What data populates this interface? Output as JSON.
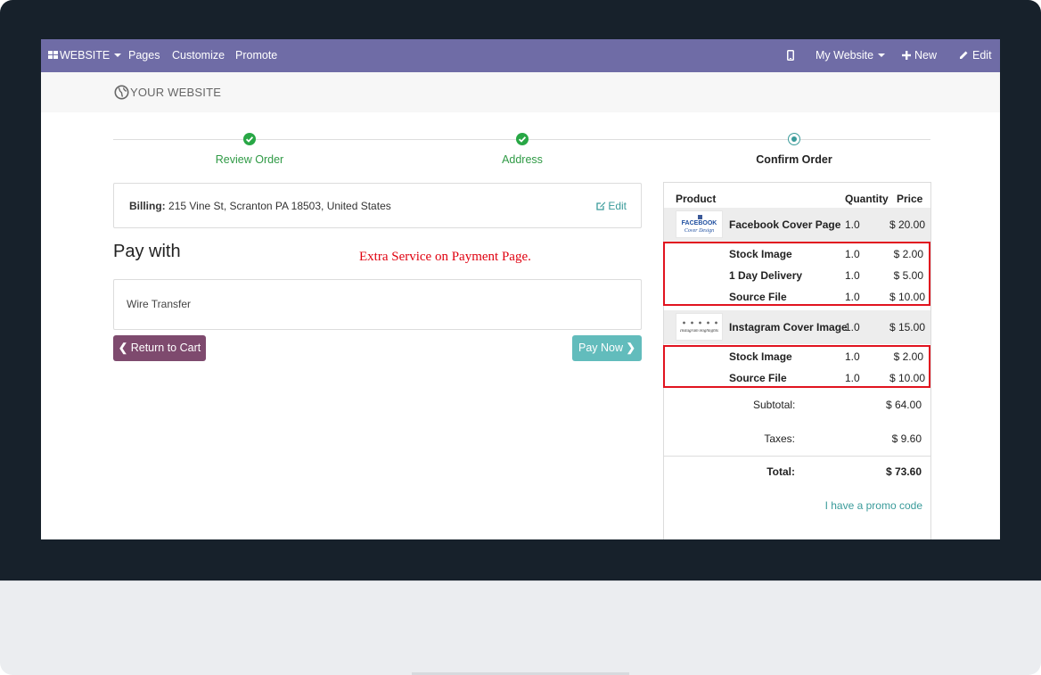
{
  "admin_bar": {
    "website_label": "WEBSITE",
    "pages_label": "Pages",
    "customize_label": "Customize",
    "promote_label": "Promote",
    "my_website_label": "My Website",
    "new_label": "New",
    "edit_label": "Edit",
    "icons": {
      "apps": "grid-icon",
      "mobile": "mobile-icon",
      "new": "plus-icon",
      "edit": "pencil-icon"
    }
  },
  "site": {
    "logo_text": "YOUR WEBSITE",
    "logo_icon": "globe-icon"
  },
  "steps": [
    {
      "label": "Review Order",
      "state": "done"
    },
    {
      "label": "Address",
      "state": "done"
    },
    {
      "label": "Confirm Order",
      "state": "current"
    }
  ],
  "billing": {
    "label": "Billing:",
    "address": "215 Vine St, Scranton PA 18503, United States",
    "edit_label": "Edit"
  },
  "payment": {
    "heading": "Pay with",
    "annotation": "Extra Service on Payment Page.",
    "method": "Wire Transfer",
    "return_label": "Return to Cart",
    "pay_label": "Pay Now"
  },
  "summary": {
    "headers": {
      "product": "Product",
      "quantity": "Quantity",
      "price": "Price"
    },
    "products": [
      {
        "name": "Facebook Cover Page",
        "quantity": "1.0",
        "price": "$ 20.00",
        "thumb_line1": "FACEBOOK",
        "thumb_line2": "Cover Design",
        "extras": [
          {
            "name": "Stock Image",
            "quantity": "1.0",
            "price": "$ 2.00"
          },
          {
            "name": "1 Day Delivery",
            "quantity": "1.0",
            "price": "$ 5.00"
          },
          {
            "name": "Source File",
            "quantity": "1.0",
            "price": "$ 10.00"
          }
        ]
      },
      {
        "name": "Instagram Cover Image",
        "quantity": "1.0",
        "price": "$ 15.00",
        "thumb_line1": "Instagram Highlights",
        "extras": [
          {
            "name": "Stock Image",
            "quantity": "1.0",
            "price": "$ 2.00"
          },
          {
            "name": "Source File",
            "quantity": "1.0",
            "price": "$ 10.00"
          }
        ]
      }
    ],
    "subtotal_label": "Subtotal:",
    "subtotal": "$ 64.00",
    "taxes_label": "Taxes:",
    "taxes": "$ 9.60",
    "total_label": "Total:",
    "total": "$ 73.60",
    "promo_label": "I have a promo code"
  },
  "colors": {
    "admin_bar": "#6f6ca6",
    "step_done": "#28a745",
    "step_current": "#3a9b9a",
    "return_button": "#7e4a6e",
    "pay_button": "#62bcbc",
    "highlight_box": "#e1131f",
    "annotation": "#e0000f",
    "link": "#3a9b9a"
  }
}
